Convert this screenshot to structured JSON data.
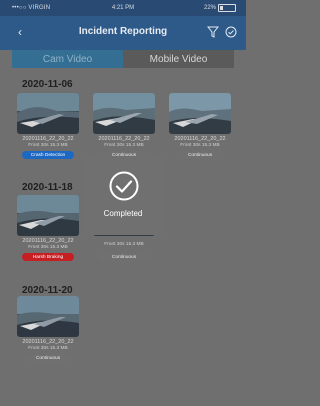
{
  "status_bar": {
    "carrier": "•••○○ VIRGIN",
    "time": "4:21 PM",
    "battery": "22%"
  },
  "header": {
    "title": "Incident Reporting",
    "back_icon": "chevron-left-icon",
    "filter_icon": "filter-icon",
    "settings_icon": "check-circle-icon"
  },
  "tabs": [
    {
      "label": "Cam Video"
    },
    {
      "label": "Mobile Video"
    }
  ],
  "sections": [
    {
      "date": "2020-11-06",
      "items": [
        {
          "filename": "20201116_22_20_22",
          "meta": "Front 30s 15.3 MB",
          "badge": "Crash Detection",
          "badge_color": "#1d68c3"
        },
        {
          "filename": "20201116_22_20_22",
          "meta": "Front 30s 15.3 MB",
          "badge": "Continuous",
          "badge_color": "#707070"
        },
        {
          "filename": "20201116_22_20_22",
          "meta": "Front 30s 15.3 MB",
          "badge": "Continuous",
          "badge_color": "#707070"
        }
      ]
    },
    {
      "date": "2020-11-18",
      "items": [
        {
          "filename": "20201116_22_20_22",
          "meta": "Front 30s 15.3 MB",
          "badge": "Harsh Braking",
          "badge_color": "#c61f23"
        },
        {
          "filename": "20201116_22_20_22",
          "meta": "Front 30s 15.3 MB",
          "badge": "Continuous",
          "badge_color": "#707070"
        }
      ]
    },
    {
      "date": "2020-11-20",
      "items": [
        {
          "filename": "20201116_22_20_22",
          "meta": "Front 30s 15.3 MB",
          "badge": "Continuous",
          "badge_color": "#707070"
        }
      ]
    }
  ],
  "toast": {
    "label": "Completed",
    "icon": "checkmark-icon"
  }
}
